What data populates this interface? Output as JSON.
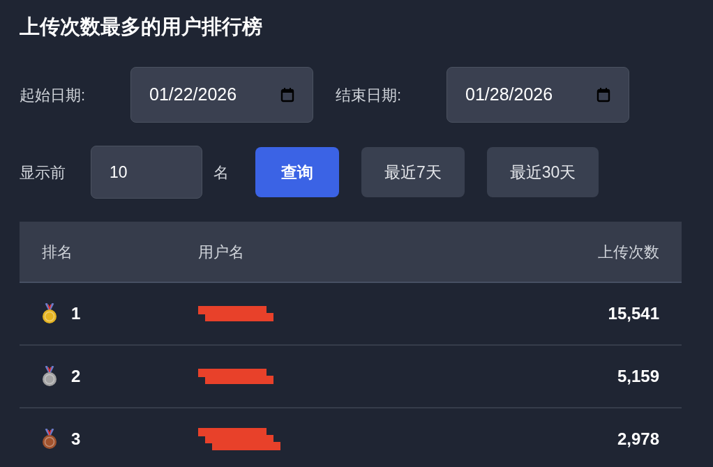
{
  "title": "上传次数最多的用户排行榜",
  "filters": {
    "start_label": "起始日期:",
    "start_value": "01/22/2026",
    "end_label": "结束日期:",
    "end_value": "01/28/2026"
  },
  "limit": {
    "prefix": "显示前",
    "value": "10",
    "suffix": "名"
  },
  "buttons": [
    {
      "label": "查询",
      "kind": "primary"
    },
    {
      "label": "最近7天",
      "kind": "secondary"
    },
    {
      "label": "最近30天",
      "kind": "secondary"
    }
  ],
  "table": {
    "columns": [
      "排名",
      "用户名",
      "上传次数"
    ],
    "rows": [
      {
        "rank": "1",
        "color": "#e5b422",
        "count": "15,541"
      },
      {
        "rank": "2",
        "color": "#a3a3a3",
        "count": "5,159"
      },
      {
        "rank": "3",
        "color": "#a0522d",
        "count": "2,978"
      }
    ]
  }
}
